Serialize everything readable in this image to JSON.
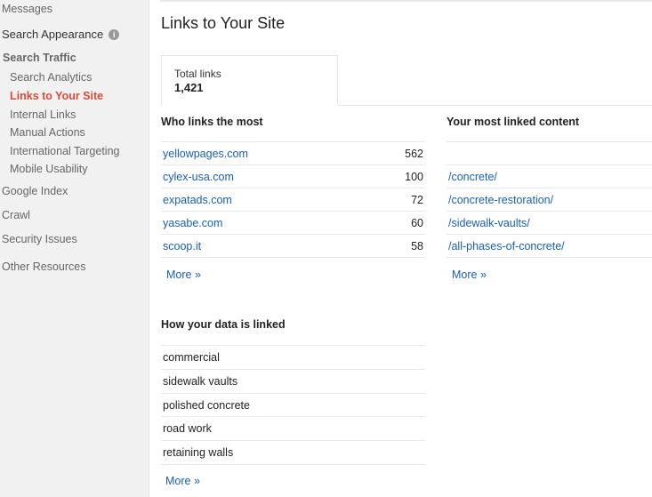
{
  "sidebar": {
    "messages": "Messages",
    "search_appearance": "Search Appearance",
    "search_traffic": "Search Traffic",
    "sub_items": [
      "Search Analytics",
      "Links to Your Site",
      "Internal Links",
      "Manual Actions",
      "International Targeting",
      "Mobile Usability"
    ],
    "google_index": "Google Index",
    "crawl": "Crawl",
    "security_issues": "Security Issues",
    "other_resources": "Other Resources",
    "info_glyph": "i"
  },
  "main": {
    "title": "Links to Your Site",
    "total": {
      "label": "Total links",
      "value": "1,421"
    },
    "who_links": {
      "heading": "Who links the most",
      "rows": [
        {
          "domain": "yellowpages.com",
          "count": "562"
        },
        {
          "domain": "cylex-usa.com",
          "count": "100"
        },
        {
          "domain": "expatads.com",
          "count": "72"
        },
        {
          "domain": "yasabe.com",
          "count": "60"
        },
        {
          "domain": "scoop.it",
          "count": "58"
        }
      ],
      "more": "More »"
    },
    "most_linked": {
      "heading": "Your most linked content",
      "rows": [
        "/concrete/",
        "/concrete-restoration/",
        "/sidewalk-vaults/",
        "/all-phases-of-concrete/"
      ],
      "more": "More »"
    },
    "how_linked": {
      "heading": "How your data is linked",
      "rows": [
        "commercial",
        "sidewalk vaults",
        "polished concrete",
        "road work",
        "retaining walls"
      ],
      "more": "More »"
    }
  },
  "colors": {
    "accent_active": "#dd4b39",
    "link": "#1a5fb4"
  }
}
